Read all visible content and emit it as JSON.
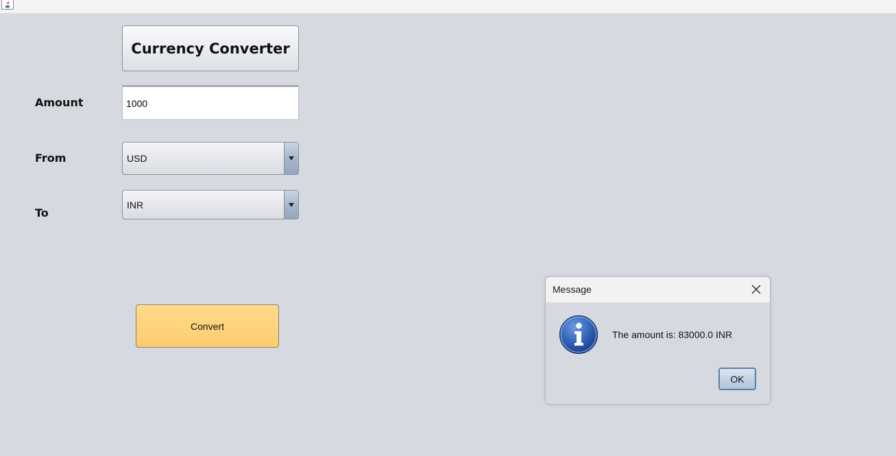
{
  "window": {
    "app_icon": "java-icon"
  },
  "form": {
    "title": "Currency Converter",
    "amount_label": "Amount",
    "amount_value": "1000",
    "from_label": "From",
    "from_value": "USD",
    "to_label": "To",
    "to_value": "INR",
    "convert_label": "Convert"
  },
  "dialog": {
    "title": "Message",
    "message": "The amount is: 83000.0 INR",
    "ok_label": "OK",
    "icon": "info-icon"
  },
  "colors": {
    "background": "#d6d9e0",
    "convert_button": "#ffd47e",
    "info_icon": "#2f62b9"
  }
}
